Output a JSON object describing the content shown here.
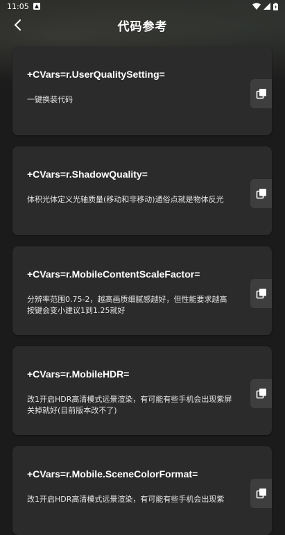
{
  "status_bar": {
    "time": "11:05"
  },
  "header": {
    "title": "代码参考"
  },
  "items": [
    {
      "code": "+CVars=r.UserQualitySetting=",
      "desc": "一键换装代码"
    },
    {
      "code": "+CVars=r.ShadowQuality=",
      "desc": "体积光体定义光轴质量(移动和非移动)通俗点就是物体反光"
    },
    {
      "code": "+CVars=r.MobileContentScaleFactor=",
      "desc": "分辨率范围0.75-2，越高画质细腻感越好，但性能要求越高按键会变小建议1到1.25就好"
    },
    {
      "code": "+CVars=r.MobileHDR=",
      "desc": "改1开启HDR高清模式远景渲染，有可能有些手机会出现紫屏关掉就好(目前版本改不了)"
    },
    {
      "code": "+CVars=r.Mobile.SceneColorFormat=",
      "desc": "改1开启HDR高清模式远景渲染，有可能有些手机会出现紫"
    }
  ],
  "colors": {
    "background": "#1b1b1b",
    "card": "#2b2b2b",
    "copy_button": "#3e3e3e",
    "text": "#ffffff"
  },
  "icons": {
    "back": "arrow-left-icon",
    "copy": "copy-icon"
  }
}
